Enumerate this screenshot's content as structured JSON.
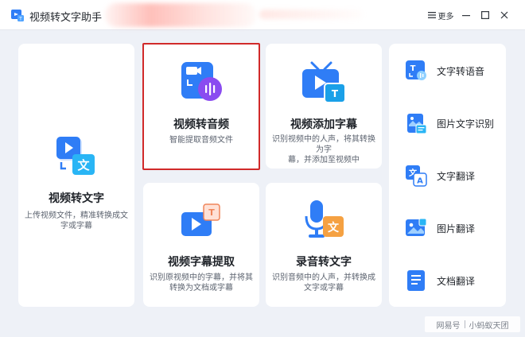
{
  "app": {
    "title": "视频转文字助手"
  },
  "window_controls": {
    "more_label": "更多"
  },
  "cards": {
    "video_to_text": {
      "title": "视频转文字",
      "desc_line1": "上传视频文件，精准转换成文",
      "desc_line2": "字或字幕"
    },
    "video_to_audio": {
      "title": "视频转音频",
      "desc": "智能提取音频文件"
    },
    "video_add_subtitle": {
      "title": "视频添加字幕",
      "desc_line1": "识别视频中的人声，将其转换 为字",
      "desc_line2": "幕，并添加至视频中"
    },
    "subtitle_extract": {
      "title": "视频字幕提取",
      "desc_line1": "识别原视频中的字幕，并将其",
      "desc_line2": "转换为文档或字幕"
    },
    "recording_to_text": {
      "title": "录音转文字",
      "desc_line1": "识别音频中的人声，并转换成",
      "desc_line2": "文字或字幕"
    }
  },
  "side_tools": [
    {
      "label": "文字转语音",
      "icon": "text-to-speech-icon"
    },
    {
      "label": "图片文字识别",
      "icon": "image-ocr-icon"
    },
    {
      "label": "文字翻译",
      "icon": "text-translate-icon"
    },
    {
      "label": "图片翻译",
      "icon": "image-translate-icon"
    },
    {
      "label": "文档翻译",
      "icon": "document-translate-icon"
    }
  ],
  "watermark": {
    "left": "网易号",
    "right": "小蚂蚁天团"
  },
  "colors": {
    "accent_blue": "#2f7df6",
    "highlight_red": "#d12a2a",
    "accent_orange": "#f5a142",
    "accent_purple": "#8a4cf0"
  }
}
